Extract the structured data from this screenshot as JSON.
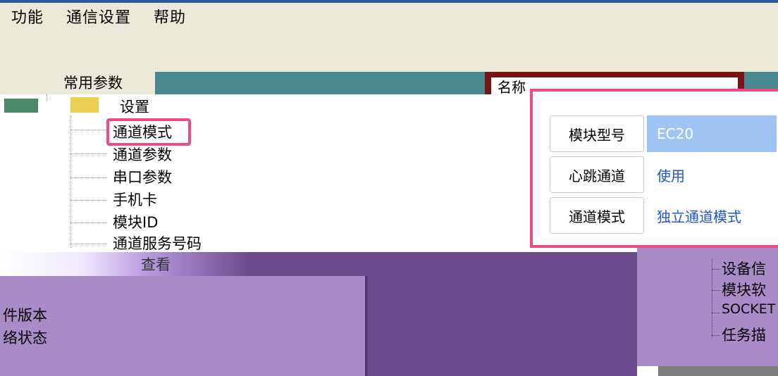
{
  "menu": {
    "items": [
      "功能",
      "通信设置",
      "帮助"
    ]
  },
  "tree": {
    "root_label": "常用参数",
    "group_label": "设置",
    "items": [
      "通道模式",
      "通道参数",
      "串口参数",
      "手机卡",
      "模块ID",
      "通道服务号码"
    ],
    "truncated_label": "查看"
  },
  "property_grid": {
    "header_label": "名称",
    "rows": [
      {
        "key": "模块型号",
        "value": "EC20"
      },
      {
        "key": "心跳通道",
        "value": "使用"
      },
      {
        "key": "通道模式",
        "value": "独立通道模式"
      }
    ]
  },
  "bottom_left": {
    "lines": [
      "件版本",
      "络状态"
    ]
  },
  "bottom_right": {
    "items": [
      "设备信",
      "模块软",
      "SOCKET",
      "任务描"
    ]
  },
  "colors": {
    "highlight": "#ee4c86",
    "selection": "#9fc3f2",
    "value_text": "#2255cc"
  }
}
